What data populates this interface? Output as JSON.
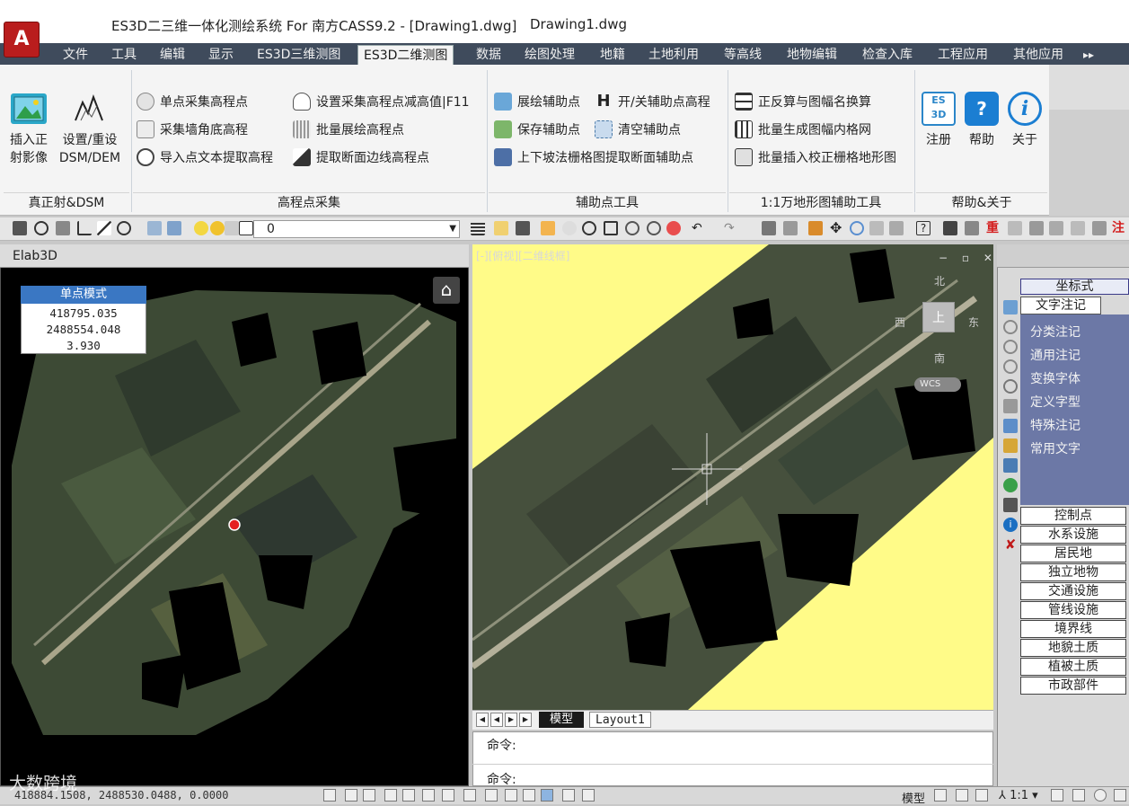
{
  "title": {
    "app": "ES3D二三维一体化测绘系统 For 南方CASS9.2 - [Drawing1.dwg]",
    "doc_tab": "Drawing1.dwg"
  },
  "menu": [
    "文件",
    "工具",
    "编辑",
    "显示",
    "ES3D三维测图",
    "ES3D二维测图",
    "数据",
    "绘图处理",
    "地籍",
    "土地利用",
    "等高线",
    "地物编辑",
    "检查入库",
    "工程应用",
    "其他应用"
  ],
  "menu_active_index": 5,
  "ribbon": {
    "group1": {
      "title": "真正射&DSM",
      "insert_ortho": "插入正",
      "insert_ortho2": "射影像",
      "set_dsm": "设置/重设",
      "set_dsm2": "DSM/DEM"
    },
    "group2": {
      "title": "高程点采集",
      "items": [
        "单点采集高程点",
        "采集墙角底高程",
        "导入点文本提取高程",
        "设置采集高程点减高值|F11",
        "批量展绘高程点",
        "提取断面边线高程点"
      ]
    },
    "group3": {
      "title": "辅助点工具",
      "items": [
        "展绘辅助点",
        "保存辅助点",
        "上下坡法栅格图提取断面辅助点",
        "开/关辅助点高程",
        "清空辅助点"
      ]
    },
    "group4": {
      "title": "1:1万地形图辅助工具",
      "items": [
        "正反算与图幅名换算",
        "批量生成图幅内格网",
        "批量插入校正栅格地形图"
      ]
    },
    "group5": {
      "title": "帮助&关于",
      "register": "注册",
      "help": "帮助",
      "about": "关于"
    }
  },
  "toolbar": {
    "layer_value": "0"
  },
  "left_panel": {
    "title": "Elab3D",
    "mode_title": "单点模式",
    "x": "418795.035",
    "y": "2488554.048",
    "z": "3.930"
  },
  "viewport": {
    "label": "[-][俯视][二维线框]",
    "compass_n": "北",
    "compass_e": "东",
    "compass_s": "南",
    "compass_w": "西",
    "compass_center": "上",
    "wcs": "WCS"
  },
  "layout_tabs": {
    "model": "模型",
    "layout1": "Layout1"
  },
  "command": {
    "line1": "命令:",
    "line2": "命令:"
  },
  "right_panel": {
    "header": "坐标式",
    "section": "文字注记",
    "items": [
      "分类注记",
      "通用注记",
      "变换字体",
      "定义字型",
      "特殊注记",
      "常用文字"
    ],
    "buttons": [
      "控制点",
      "水系设施",
      "居民地",
      "独立地物",
      "交通设施",
      "管线设施",
      "境界线",
      "地貌土质",
      "植被土质",
      "市政部件"
    ]
  },
  "status": {
    "coords": "418884.1508, 2488530.0488, 0.0000",
    "model": "模型",
    "scale": "1:1",
    "watermark": "大数跨境"
  }
}
